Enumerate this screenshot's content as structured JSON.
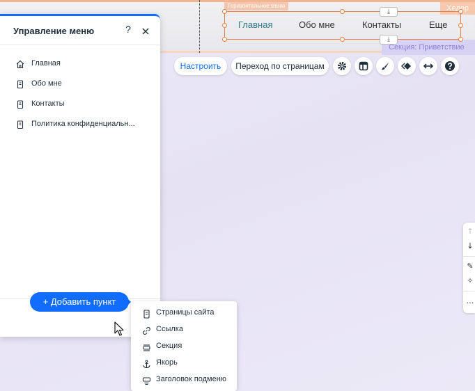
{
  "canvas": {
    "header_tag": "Хедер",
    "section_tag": "Секция: Приветствие",
    "horizontal_menu_tag": "Горизонтальное меню",
    "horizontal_menu_items": [
      {
        "label": "Главная",
        "active": true
      },
      {
        "label": "Обо мне",
        "active": false
      },
      {
        "label": "Контакты",
        "active": false
      },
      {
        "label": "Еще",
        "active": false
      }
    ]
  },
  "toolbar": {
    "customize_label": "Настроить",
    "navigate_label": "Переход по страницам",
    "icons": [
      "gear-icon",
      "layout-icon",
      "design-brush-icon",
      "animation-icon",
      "stretch-icon",
      "help-icon"
    ]
  },
  "panel": {
    "title": "Управление меню",
    "help_glyph": "?",
    "items": [
      {
        "label": "Главная",
        "icon": "home-icon"
      },
      {
        "label": "Обо мне",
        "icon": "page-icon"
      },
      {
        "label": "Контакты",
        "icon": "page-icon"
      },
      {
        "label": "Политика конфиденциальн...",
        "icon": "page-icon"
      }
    ],
    "add_button_label": "+ Добавить пункт"
  },
  "dropdown": {
    "items": [
      {
        "label": "Страницы сайта",
        "icon": "page-icon"
      },
      {
        "label": "Ссылка",
        "icon": "link-icon"
      },
      {
        "label": "Секция",
        "icon": "section-icon"
      },
      {
        "label": "Якорь",
        "icon": "anchor-icon"
      },
      {
        "label": "Заголовок подменю",
        "icon": "submenu-header-icon"
      }
    ]
  },
  "colors": {
    "accent": "#116dff",
    "selection_orange": "#f07e3d",
    "header_tag_bg": "#f7c7ae",
    "section_tag_bg": "#d7d1f3"
  }
}
